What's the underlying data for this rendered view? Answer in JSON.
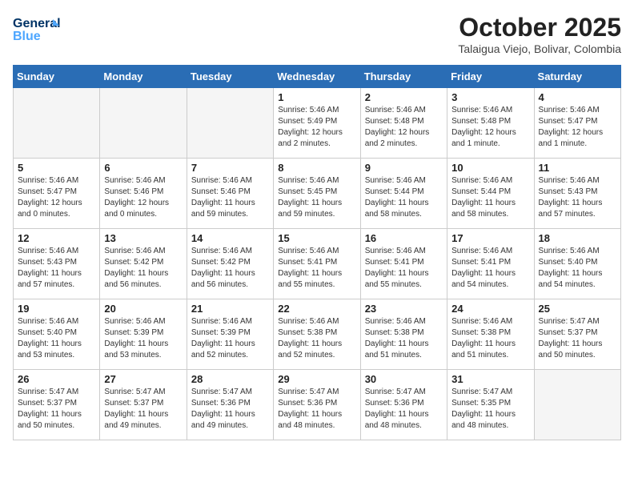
{
  "header": {
    "logo_line1": "General",
    "logo_line2": "Blue",
    "month": "October 2025",
    "location": "Talaigua Viejo, Bolivar, Colombia"
  },
  "weekdays": [
    "Sunday",
    "Monday",
    "Tuesday",
    "Wednesday",
    "Thursday",
    "Friday",
    "Saturday"
  ],
  "weeks": [
    [
      {
        "day": "",
        "info": ""
      },
      {
        "day": "",
        "info": ""
      },
      {
        "day": "",
        "info": ""
      },
      {
        "day": "1",
        "info": "Sunrise: 5:46 AM\nSunset: 5:49 PM\nDaylight: 12 hours\nand 2 minutes."
      },
      {
        "day": "2",
        "info": "Sunrise: 5:46 AM\nSunset: 5:48 PM\nDaylight: 12 hours\nand 2 minutes."
      },
      {
        "day": "3",
        "info": "Sunrise: 5:46 AM\nSunset: 5:48 PM\nDaylight: 12 hours\nand 1 minute."
      },
      {
        "day": "4",
        "info": "Sunrise: 5:46 AM\nSunset: 5:47 PM\nDaylight: 12 hours\nand 1 minute."
      }
    ],
    [
      {
        "day": "5",
        "info": "Sunrise: 5:46 AM\nSunset: 5:47 PM\nDaylight: 12 hours\nand 0 minutes."
      },
      {
        "day": "6",
        "info": "Sunrise: 5:46 AM\nSunset: 5:46 PM\nDaylight: 12 hours\nand 0 minutes."
      },
      {
        "day": "7",
        "info": "Sunrise: 5:46 AM\nSunset: 5:46 PM\nDaylight: 11 hours\nand 59 minutes."
      },
      {
        "day": "8",
        "info": "Sunrise: 5:46 AM\nSunset: 5:45 PM\nDaylight: 11 hours\nand 59 minutes."
      },
      {
        "day": "9",
        "info": "Sunrise: 5:46 AM\nSunset: 5:44 PM\nDaylight: 11 hours\nand 58 minutes."
      },
      {
        "day": "10",
        "info": "Sunrise: 5:46 AM\nSunset: 5:44 PM\nDaylight: 11 hours\nand 58 minutes."
      },
      {
        "day": "11",
        "info": "Sunrise: 5:46 AM\nSunset: 5:43 PM\nDaylight: 11 hours\nand 57 minutes."
      }
    ],
    [
      {
        "day": "12",
        "info": "Sunrise: 5:46 AM\nSunset: 5:43 PM\nDaylight: 11 hours\nand 57 minutes."
      },
      {
        "day": "13",
        "info": "Sunrise: 5:46 AM\nSunset: 5:42 PM\nDaylight: 11 hours\nand 56 minutes."
      },
      {
        "day": "14",
        "info": "Sunrise: 5:46 AM\nSunset: 5:42 PM\nDaylight: 11 hours\nand 56 minutes."
      },
      {
        "day": "15",
        "info": "Sunrise: 5:46 AM\nSunset: 5:41 PM\nDaylight: 11 hours\nand 55 minutes."
      },
      {
        "day": "16",
        "info": "Sunrise: 5:46 AM\nSunset: 5:41 PM\nDaylight: 11 hours\nand 55 minutes."
      },
      {
        "day": "17",
        "info": "Sunrise: 5:46 AM\nSunset: 5:41 PM\nDaylight: 11 hours\nand 54 minutes."
      },
      {
        "day": "18",
        "info": "Sunrise: 5:46 AM\nSunset: 5:40 PM\nDaylight: 11 hours\nand 54 minutes."
      }
    ],
    [
      {
        "day": "19",
        "info": "Sunrise: 5:46 AM\nSunset: 5:40 PM\nDaylight: 11 hours\nand 53 minutes."
      },
      {
        "day": "20",
        "info": "Sunrise: 5:46 AM\nSunset: 5:39 PM\nDaylight: 11 hours\nand 53 minutes."
      },
      {
        "day": "21",
        "info": "Sunrise: 5:46 AM\nSunset: 5:39 PM\nDaylight: 11 hours\nand 52 minutes."
      },
      {
        "day": "22",
        "info": "Sunrise: 5:46 AM\nSunset: 5:38 PM\nDaylight: 11 hours\nand 52 minutes."
      },
      {
        "day": "23",
        "info": "Sunrise: 5:46 AM\nSunset: 5:38 PM\nDaylight: 11 hours\nand 51 minutes."
      },
      {
        "day": "24",
        "info": "Sunrise: 5:46 AM\nSunset: 5:38 PM\nDaylight: 11 hours\nand 51 minutes."
      },
      {
        "day": "25",
        "info": "Sunrise: 5:47 AM\nSunset: 5:37 PM\nDaylight: 11 hours\nand 50 minutes."
      }
    ],
    [
      {
        "day": "26",
        "info": "Sunrise: 5:47 AM\nSunset: 5:37 PM\nDaylight: 11 hours\nand 50 minutes."
      },
      {
        "day": "27",
        "info": "Sunrise: 5:47 AM\nSunset: 5:37 PM\nDaylight: 11 hours\nand 49 minutes."
      },
      {
        "day": "28",
        "info": "Sunrise: 5:47 AM\nSunset: 5:36 PM\nDaylight: 11 hours\nand 49 minutes."
      },
      {
        "day": "29",
        "info": "Sunrise: 5:47 AM\nSunset: 5:36 PM\nDaylight: 11 hours\nand 48 minutes."
      },
      {
        "day": "30",
        "info": "Sunrise: 5:47 AM\nSunset: 5:36 PM\nDaylight: 11 hours\nand 48 minutes."
      },
      {
        "day": "31",
        "info": "Sunrise: 5:47 AM\nSunset: 5:35 PM\nDaylight: 11 hours\nand 48 minutes."
      },
      {
        "day": "",
        "info": ""
      }
    ]
  ]
}
